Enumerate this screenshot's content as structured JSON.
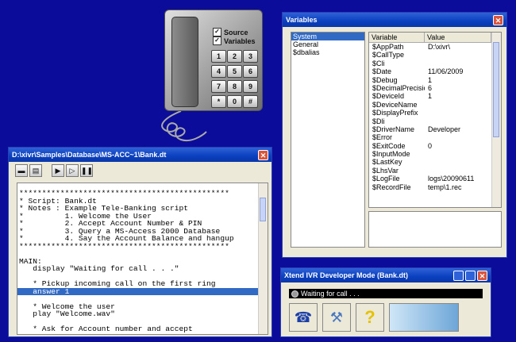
{
  "phone": {
    "source_label": "Source",
    "variables_label": "Variables",
    "keys": [
      "1",
      "2",
      "3",
      "4",
      "5",
      "6",
      "7",
      "8",
      "9",
      "*",
      "0",
      "#"
    ]
  },
  "variables_window": {
    "title": "Variables",
    "categories": [
      "System",
      "General",
      "$dbalias"
    ],
    "columns": [
      "Variable",
      "Value"
    ],
    "rows": [
      [
        "$AppPath",
        "D:\\xivr\\"
      ],
      [
        "$CallType",
        ""
      ],
      [
        "$Cli",
        ""
      ],
      [
        "$Date",
        "11/06/2009"
      ],
      [
        "$Debug",
        "1"
      ],
      [
        "$DecimalPrecision",
        "6"
      ],
      [
        "$DeviceId",
        "1"
      ],
      [
        "$DeviceName",
        ""
      ],
      [
        "$DisplayPrefix",
        ""
      ],
      [
        "$Dli",
        ""
      ],
      [
        "$DriverName",
        "Developer"
      ],
      [
        "$Error",
        ""
      ],
      [
        "$ExitCode",
        "0"
      ],
      [
        "$InputMode",
        ""
      ],
      [
        "$LastKey",
        ""
      ],
      [
        "$LhsVar",
        ""
      ],
      [
        "$LogFile",
        "logs\\20090611"
      ],
      [
        "$RecordFile",
        "temp\\1.rec"
      ]
    ]
  },
  "script_window": {
    "title": "D:\\xivr\\Samples\\Database\\MS-ACC~1\\Bank.dt",
    "lines": [
      "**********************************************",
      "* Script: Bank.dt",
      "* Notes : Example Tele-Banking script",
      "*         1. Welcome the User",
      "*         2. Accept Account Number & PIN",
      "*         3. Query a MS-Access 2000 Database",
      "*         4. Say the Account Balance and hangup",
      "**********************************************",
      "",
      "MAIN:",
      "   display \"Waiting for call . . .\"",
      "",
      "   * Pickup incoming call on the first ring",
      "   answer 1",
      "",
      "   * Welcome the user",
      "   play \"Welcome.wav\"",
      "",
      "   * Ask for Account number and accept"
    ]
  },
  "xtend_window": {
    "title": "Xtend IVR Developer Mode  (Bank.dt)",
    "status": "Waiting for call . . ."
  }
}
